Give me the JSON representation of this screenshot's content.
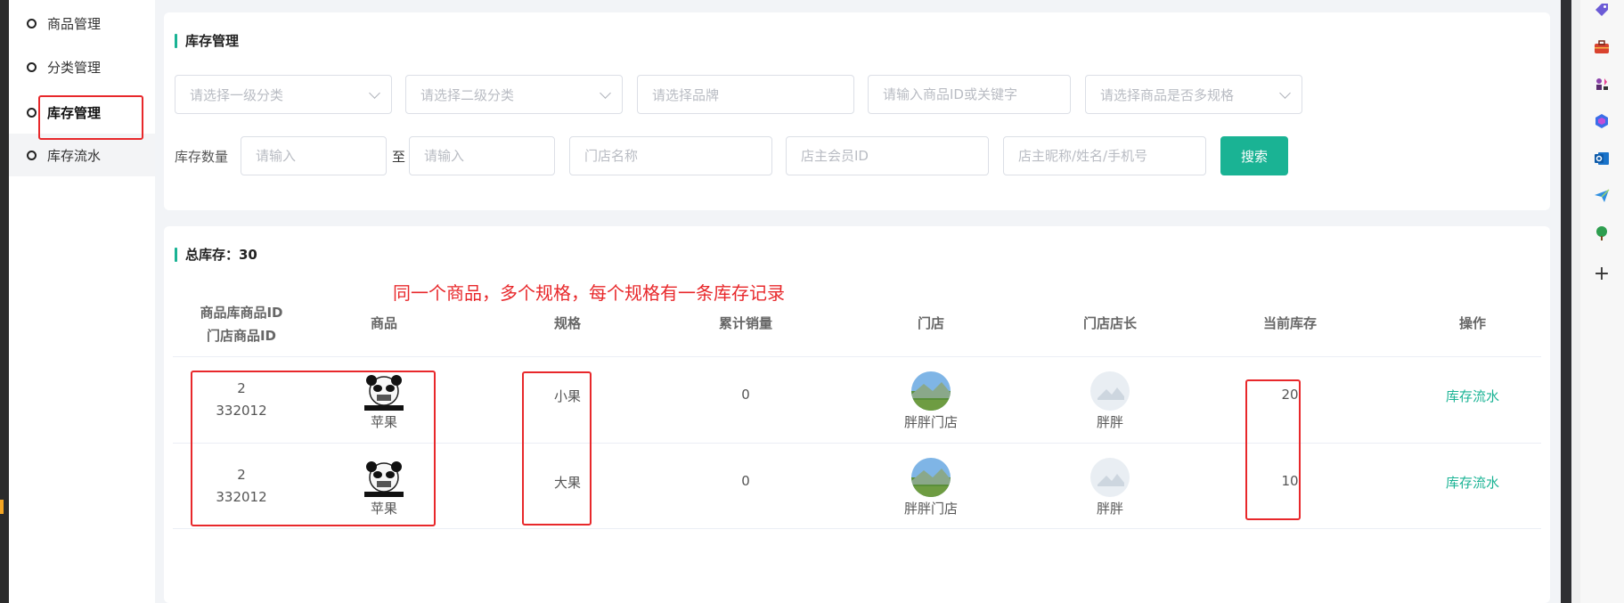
{
  "sidebar": {
    "items": [
      {
        "label": "商品管理"
      },
      {
        "label": "分类管理"
      },
      {
        "label": "库存管理"
      },
      {
        "label": "库存流水"
      }
    ]
  },
  "filter": {
    "title": "库存管理",
    "category1_placeholder": "请选择一级分类",
    "category2_placeholder": "请选择二级分类",
    "brand_placeholder": "请选择品牌",
    "keyword_placeholder": "请输入商品ID或关键字",
    "multispec_placeholder": "请选择商品是否多规格",
    "stock_label": "库存数量",
    "stock_min_placeholder": "请输入",
    "to_label": "至",
    "stock_max_placeholder": "请输入",
    "store_name_placeholder": "门店名称",
    "owner_id_placeholder": "店主会员ID",
    "owner_info_placeholder": "店主昵称/姓名/手机号",
    "search_label": "搜索"
  },
  "list": {
    "title": "总库存：30",
    "annotation": "同一个商品，多个规格，每个规格有一条库存记录",
    "headers": {
      "id_line1": "商品库商品ID",
      "id_line2": "门店商品ID",
      "product": "商品",
      "spec": "规格",
      "sales": "累计销量",
      "store": "门店",
      "owner": "门店店长",
      "stock": "当前库存",
      "action": "操作"
    },
    "rows": [
      {
        "lib_id": "2",
        "store_goods_id": "332012",
        "product": "苹果",
        "spec": "小果",
        "sales": "0",
        "store": "胖胖门店",
        "owner": "胖胖",
        "stock": "20",
        "action": "库存流水"
      },
      {
        "lib_id": "2",
        "store_goods_id": "332012",
        "product": "苹果",
        "spec": "大果",
        "sales": "0",
        "store": "胖胖门店",
        "owner": "胖胖",
        "stock": "10",
        "action": "库存流水"
      }
    ]
  },
  "colors": {
    "accent": "#1ab394",
    "annotation_red": "#e8282b"
  }
}
